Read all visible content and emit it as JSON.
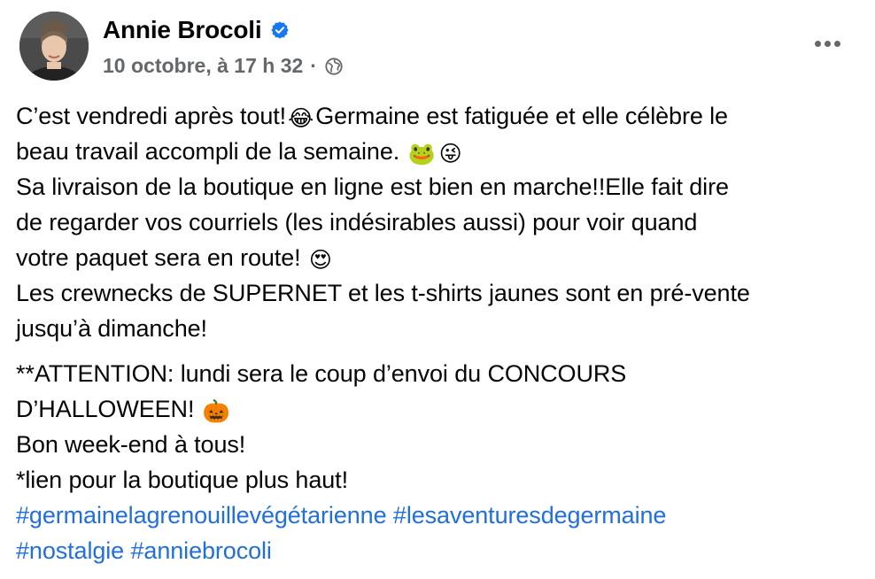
{
  "post": {
    "author": "Annie Brocoli",
    "timestamp": "10 octobre, à 17 h 32",
    "separator": "·",
    "privacy_icon": "globe-icon",
    "verified_icon": "verified-badge-icon",
    "more_icon": "more-options-icon"
  },
  "content": {
    "p1": {
      "l1_a": "C’est vendredi après tout!",
      "l1_emoji": "😂",
      "l1_b": "Germaine est fatiguée et elle célèbre le",
      "l2_a": "beau travail accompli de la semaine.",
      "l2_emoji1": "🐸",
      "l2_emoji2": "😜",
      "l3": "Sa livraison de la boutique en ligne est bien en marche!!Elle fait dire",
      "l4": "de regarder vos courriels (les indésirables aussi) pour voir quand",
      "l5_a": "votre paquet sera en route!",
      "l5_emoji": "😍",
      "l6": "Les crewnecks de SUPERNET et les t-shirts jaunes sont en pré-vente",
      "l7": "jusqu’à dimanche!"
    },
    "p2": {
      "l1": "**ATTENTION: lundi sera le coup d’envoi du CONCOURS",
      "l2_a": "D’HALLOWEEN!",
      "l2_emoji": "🎃",
      "l3": "Bon week-end à tous!",
      "l4": "*lien pour la boutique plus haut!"
    },
    "hashtags": [
      "#germainelagrenouillevégétarienne",
      "#lesaventuresdegermaine",
      "#nostalgie",
      "#anniebrocoli"
    ]
  },
  "colors": {
    "text": "#050505",
    "meta": "#65676b",
    "link": "#216fdb",
    "verified": "#1877f2"
  }
}
